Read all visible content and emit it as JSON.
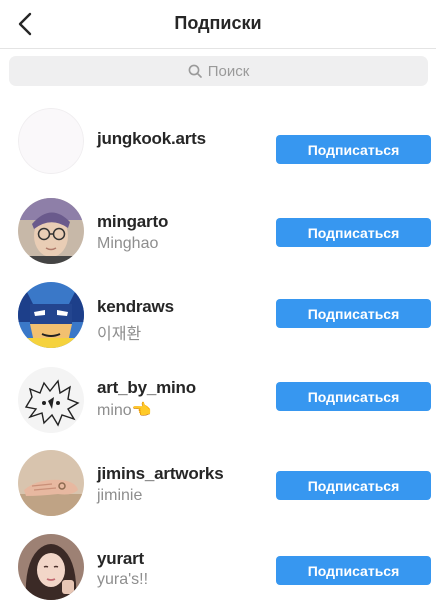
{
  "header": {
    "title": "Подписки"
  },
  "search": {
    "placeholder": "Поиск"
  },
  "follow_label": "Подписаться",
  "users": [
    {
      "username": "jungkook.arts",
      "name": ""
    },
    {
      "username": "mingarto",
      "name": "Minghao"
    },
    {
      "username": "kendraws",
      "name": "이재환"
    },
    {
      "username": "art_by_mino",
      "name": "mino👈"
    },
    {
      "username": "jimins_artworks",
      "name": "jiminie"
    },
    {
      "username": "yurart",
      "name": "yura's!!"
    }
  ],
  "colors": {
    "button": "#3797f0",
    "text": "#262626",
    "secondary": "#8e8e8e"
  }
}
